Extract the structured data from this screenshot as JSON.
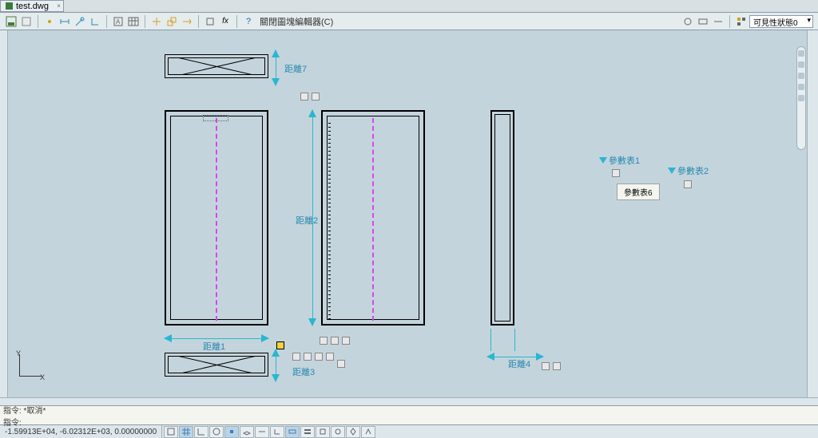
{
  "tab": {
    "filename": "test.dwg"
  },
  "toolbar": {
    "block_editor_label": "關閉圖塊編輯器(C)",
    "visibility_dropdown": "可見性狀態0"
  },
  "dimensions": {
    "dist1": "距離1",
    "dist2": "距離2",
    "dist3": "距離3",
    "dist4": "距離4",
    "dist7": "距離7"
  },
  "params": {
    "table1": "參數表1",
    "table2": "參數表2",
    "button": "參數表6"
  },
  "ucs": {
    "x": "X",
    "y": "Y"
  },
  "command": {
    "line1": "指令: *取消*",
    "line2": "指令:"
  },
  "status": {
    "coords": "-1.59913E+04, -6.02312E+03, 0.00000000"
  }
}
